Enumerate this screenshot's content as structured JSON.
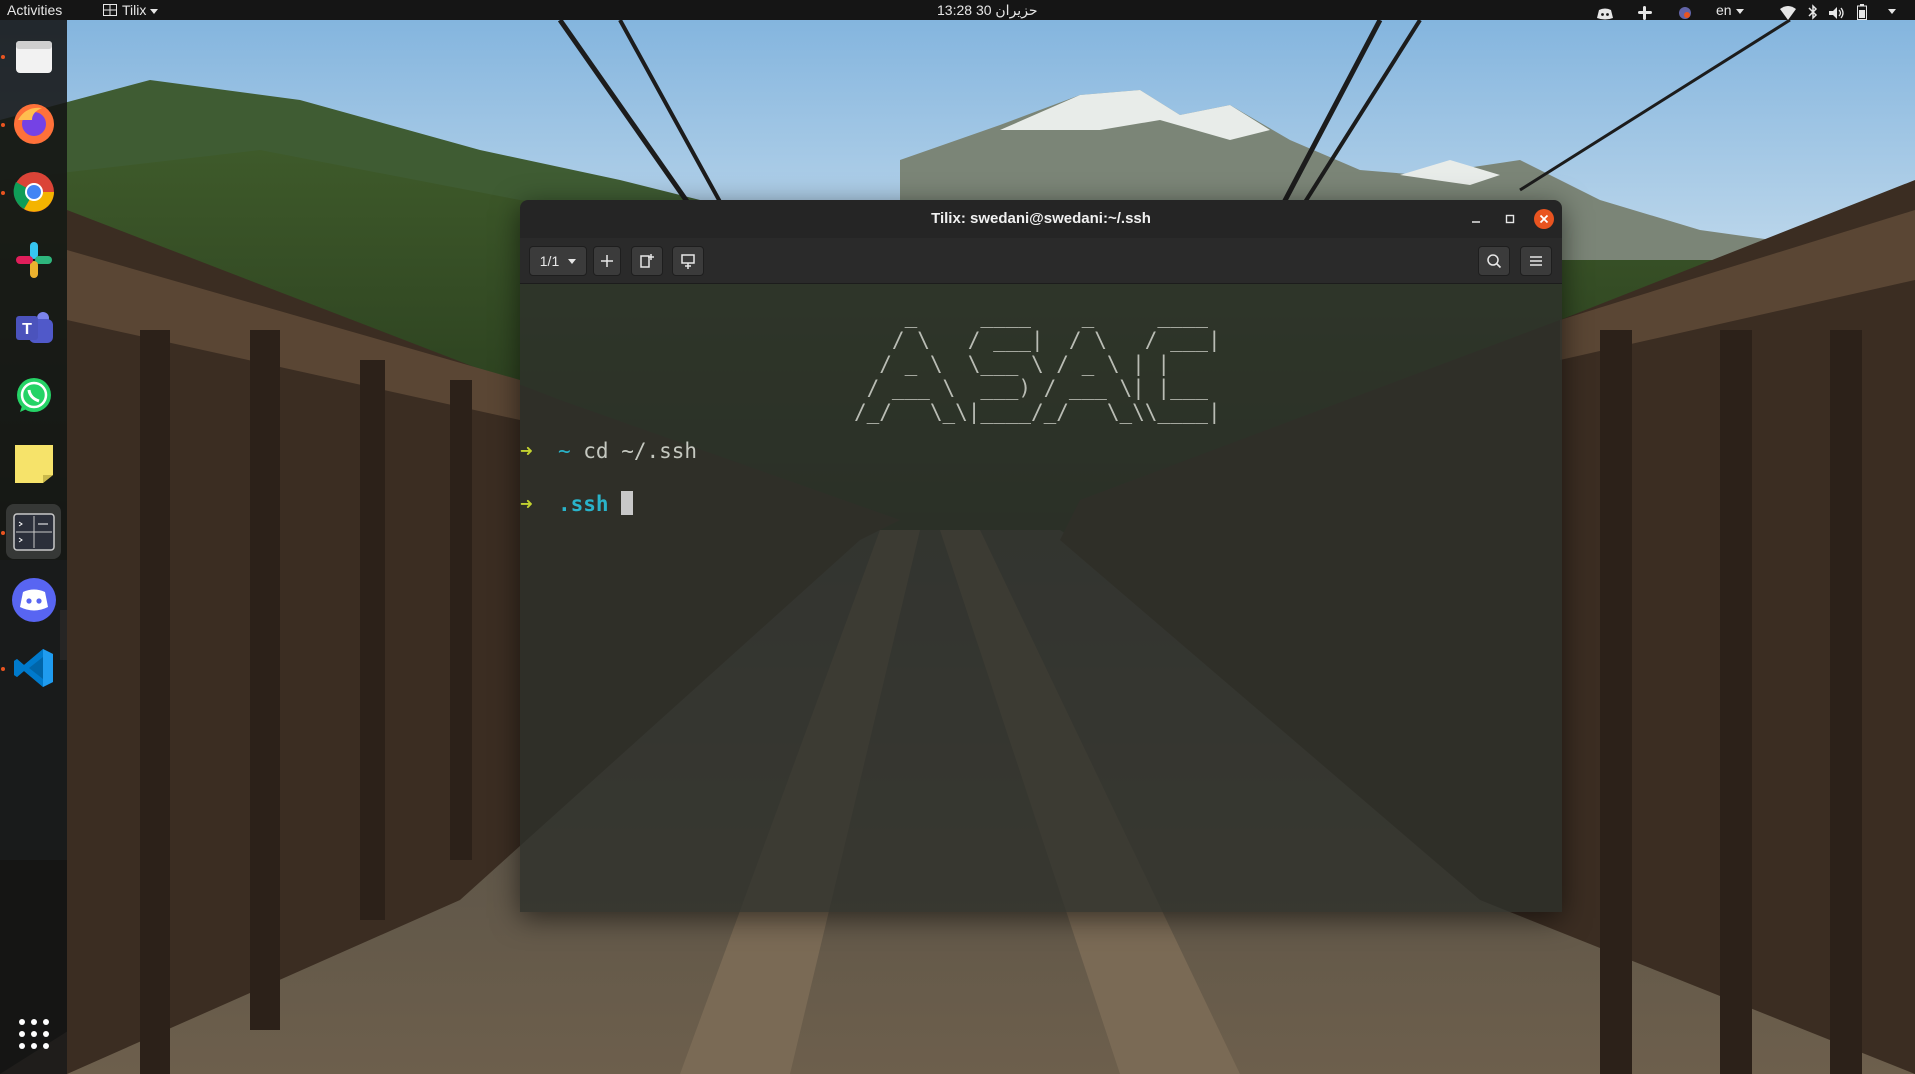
{
  "topbar": {
    "activities": "Activities",
    "app_menu": "Tilix",
    "clock": "13:28 حزيران 30",
    "language": "en"
  },
  "dock": {
    "items": [
      {
        "name": "files",
        "icon": "files-icon",
        "running": true
      },
      {
        "name": "firefox",
        "icon": "firefox-icon",
        "running": true
      },
      {
        "name": "chrome",
        "icon": "chrome-icon",
        "running": true
      },
      {
        "name": "slack",
        "icon": "slack-icon",
        "running": false
      },
      {
        "name": "teams",
        "icon": "teams-icon",
        "running": false
      },
      {
        "name": "whatsapp",
        "icon": "whatsapp-icon",
        "running": false
      },
      {
        "name": "notes",
        "icon": "sticky-notes-icon",
        "running": false
      },
      {
        "name": "tilix",
        "icon": "terminal-icon",
        "running": true,
        "active": true
      },
      {
        "name": "discord",
        "icon": "discord-icon",
        "running": false
      },
      {
        "name": "vscode",
        "icon": "vscode-icon",
        "running": true
      }
    ],
    "show_apps_icon": "grid-icon"
  },
  "window": {
    "title": "Tilix: swedani@swedani:~/.ssh",
    "session_selector": "1/1",
    "accent_close": "#e95420"
  },
  "terminal": {
    "banner_lines": [
      "    _     ____    _     ____",
      "   / \\   / ___|  / \\   / ___|",
      "  / _ \\  \\___ \\ / _ \\ | |",
      " / ___ \\  ___) / ___ \\| |___",
      "/_/   \\_\\|____/_/   \\_\\\\____|"
    ],
    "prompt_arrow": "➜",
    "line1_dir": "~",
    "line1_cmd": "cd ~/.ssh",
    "line2_dir": ".ssh"
  },
  "colors": {
    "prompt_arrow": "#c3d230",
    "dir": "#29b3c9",
    "text": "#c5c8c0"
  }
}
